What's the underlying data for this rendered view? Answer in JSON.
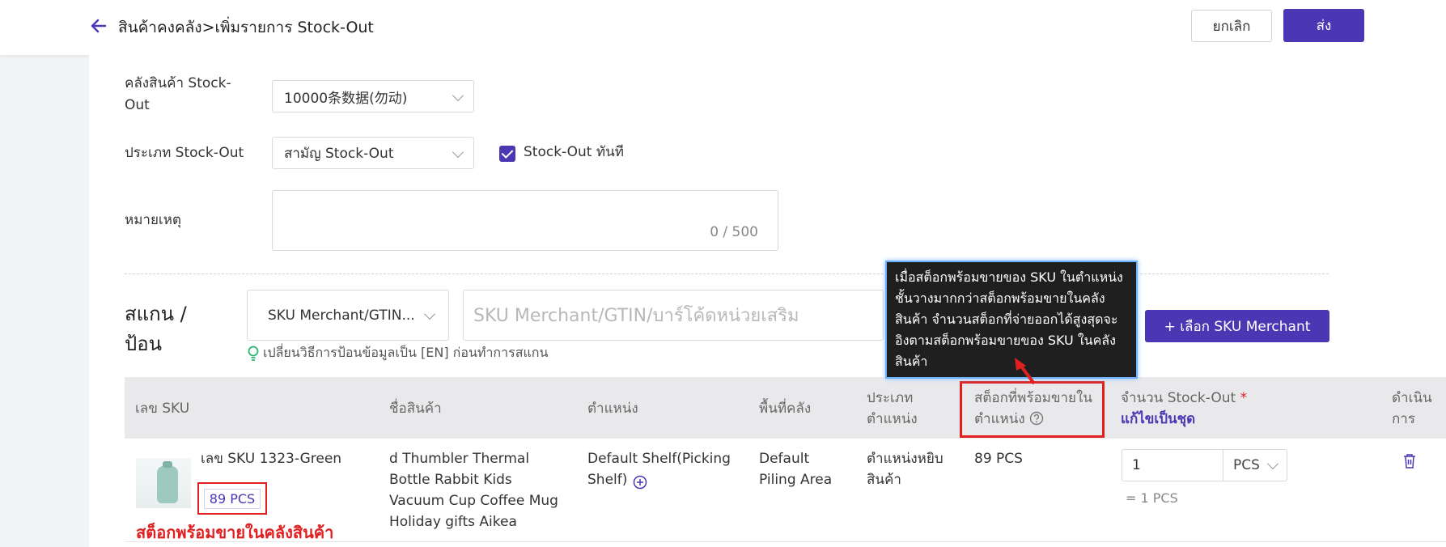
{
  "header": {
    "breadcrumb": "สินค้าคงคลัง>เพิ่มรายการ Stock-Out",
    "cancel_label": "ยกเลิก",
    "send_label": "ส่ง"
  },
  "form": {
    "warehouse_label": "คลังสินค้า Stock-Out",
    "warehouse_value": "10000条数据(勿动)",
    "type_label": "ประเภท Stock-Out",
    "type_value": "สามัญ Stock-Out",
    "instant_label": "Stock-Out ทันที",
    "instant_checked": true,
    "remark_label": "หมายเหตุ",
    "remark_counter": "0 / 500"
  },
  "scan": {
    "label": "สแกน / ป้อน",
    "mode_value": "SKU Merchant/GTIN...",
    "input_placeholder": "SKU Merchant/GTIN/บาร์โค้ดหน่วยเสริม",
    "hint": "เปลี่ยนวิธีการป้อนข้อมูลเป็น [EN] ก่อนทำการสแกน",
    "select_button": "+ เลือก SKU Merchant"
  },
  "tooltip": {
    "text": "เมื่อสต็อกพร้อมขายของ SKU ในตำแหน่งชั้นวางมากกว่าสต็อกพร้อมขายในคลังสินค้า จำนวนสต็อกที่จ่ายออกได้สูงสุดจะอิงตามสต็อกพร้อมขายของ SKU ในคลังสินค้า"
  },
  "table": {
    "headers": {
      "sku": "เลข SKU",
      "name": "ชื่อสินค้า",
      "location": "ตำแหน่ง",
      "area": "พื้นที่คลัง",
      "location_type": "ประเภทตำแหน่ง",
      "available": "สต็อกที่พร้อมขายในตำแหน่ง",
      "qty": "จำนวน Stock-Out",
      "qty_required": "*",
      "qty_link": "แก้ไขเป็นชุด",
      "action": "ดำเนินการ"
    },
    "row": {
      "sku": "เลข SKU 1323-Green",
      "sku_stock": "89 PCS",
      "name": "d Thumbler Thermal Bottle Rabbit Kids Vacuum Cup Coffee Mug Holiday gifts Aikea",
      "location": "Default Shelf(Picking Shelf)",
      "area": "Default Piling Area",
      "location_type": "ตำแหน่งหยิบสินค้า",
      "available": "89 PCS",
      "qty": "1",
      "unit": "PCS",
      "equals": "= 1 PCS"
    },
    "annotation": "สต็อกพร้อมขายในคลังสินค้า"
  },
  "colors": {
    "accent": "#4b36b3",
    "highlight": "#e02020"
  }
}
